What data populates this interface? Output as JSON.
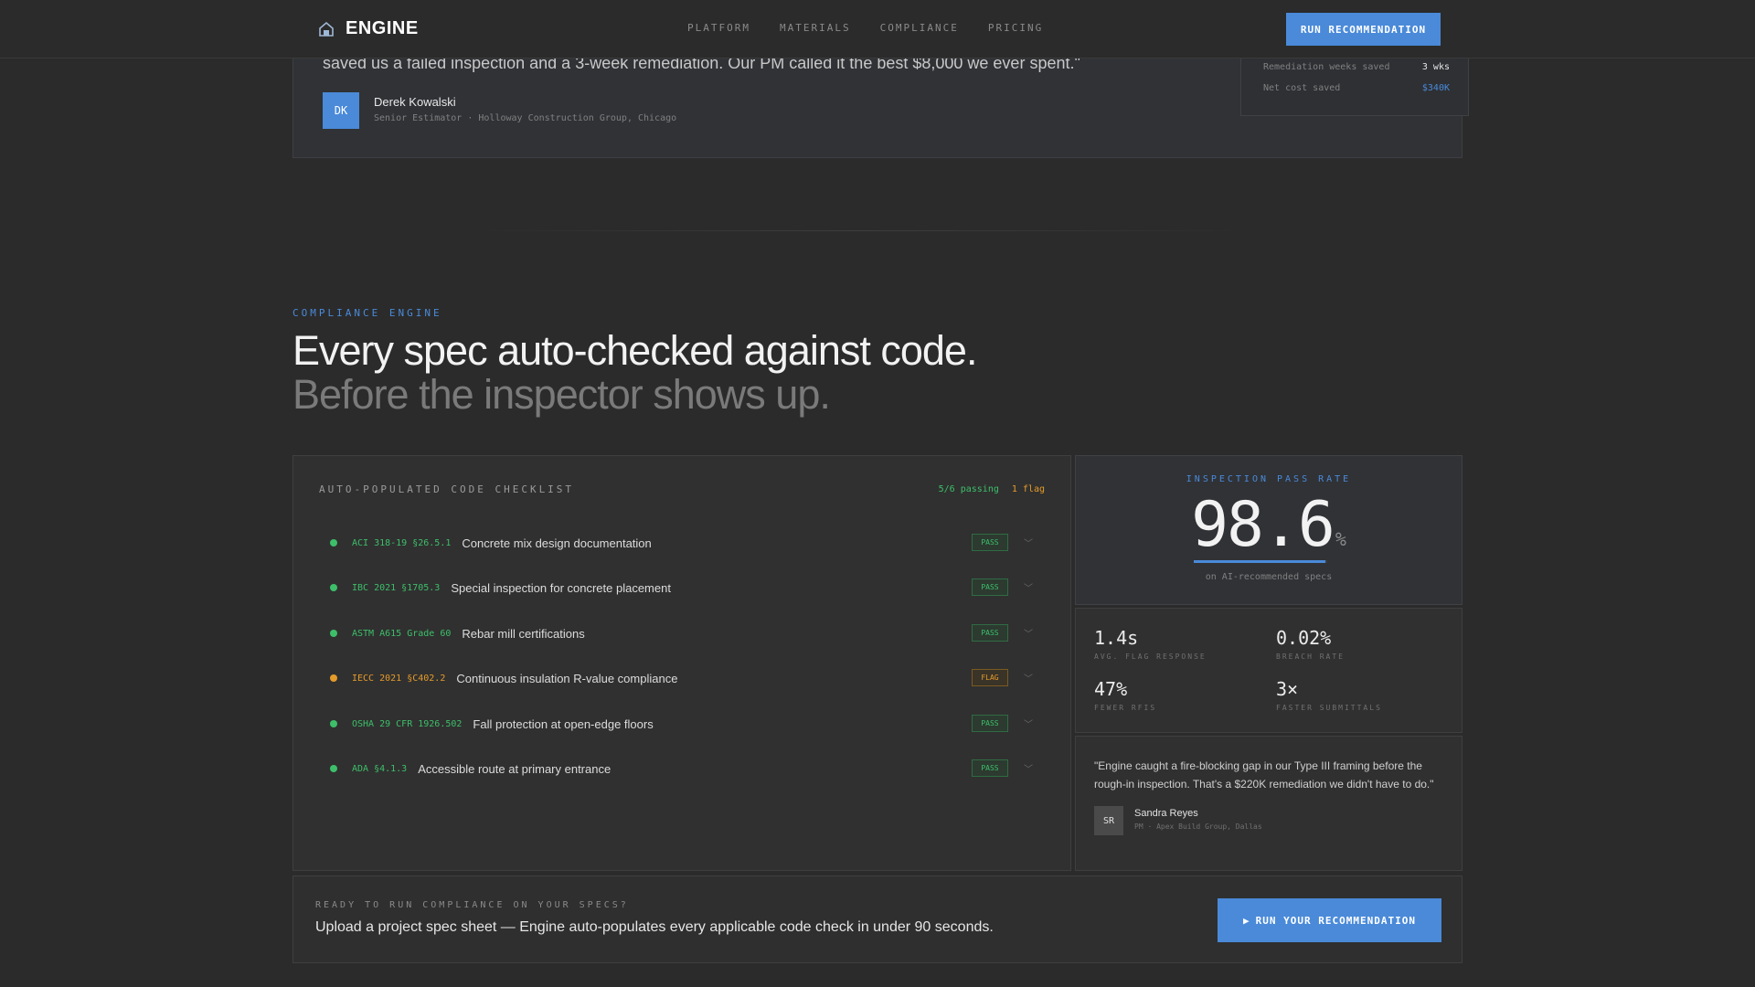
{
  "nav": {
    "brand": "ENGINE",
    "links": [
      "PLATFORM",
      "MATERIALS",
      "COMPLIANCE",
      "PRICING"
    ],
    "cta": "RUN RECOMMENDATION"
  },
  "top_testimonial": {
    "quote": "saved us a failed inspection and a 3-week remediation. Our PM called it the best $8,000 we ever spent.\"",
    "initials": "DK",
    "name": "Derek Kowalski",
    "role": "Senior Estimator · Holloway Construction Group, Chicago",
    "metrics": [
      {
        "label": "Remediation weeks saved",
        "value": "3 wks"
      },
      {
        "label": "Net cost saved",
        "value": "$340K"
      }
    ]
  },
  "section": {
    "eyebrow": "COMPLIANCE ENGINE",
    "headline": "Every spec auto-checked against code.",
    "subheadline": "Before the inspector shows up."
  },
  "checklist": {
    "title": "AUTO-POPULATED CODE CHECKLIST",
    "passing": "5/6 passing",
    "flags": "1 flag",
    "items": [
      {
        "code": "ACI 318-19 §26.5.1",
        "text": "Concrete mix design documentation",
        "status": "PASS"
      },
      {
        "code": "IBC 2021 §1705.3",
        "text": "Special inspection for concrete placement",
        "status": "PASS"
      },
      {
        "code": "ASTM A615 Grade 60",
        "text": "Rebar mill certifications",
        "status": "PASS"
      },
      {
        "code": "IECC 2021 §C402.2",
        "text": "Continuous insulation R-value compliance",
        "status": "FLAG"
      },
      {
        "code": "OSHA 29 CFR 1926.502",
        "text": "Fall protection at open-edge floors",
        "status": "PASS"
      },
      {
        "code": "ADA §4.1.3",
        "text": "Accessible route at primary entrance",
        "status": "PASS"
      }
    ]
  },
  "pass_rate": {
    "label": "INSPECTION PASS RATE",
    "value": "98.6",
    "unit": "%",
    "fill": 0.986,
    "sub": "on AI-recommended specs"
  },
  "stats": [
    {
      "value": "1.4s",
      "label": "AVG. FLAG RESPONSE"
    },
    {
      "value": "0.02%",
      "label": "BREACH RATE"
    },
    {
      "value": "47%",
      "label": "FEWER RFIS"
    },
    {
      "value": "3×",
      "label": "FASTER SUBMITTALS"
    }
  ],
  "side_quote": {
    "text": "\"Engine caught a fire-blocking gap in our Type III framing before the rough-in inspection. That's a $220K remediation we didn't have to do.\"",
    "initials": "SR",
    "name": "Sandra Reyes",
    "role": "PM · Apex Build Group, Dallas"
  },
  "cta": {
    "eyebrow": "READY TO RUN COMPLIANCE ON YOUR SPECS?",
    "text": "Upload a project spec sheet — Engine auto-populates every applicable code check in under 90 seconds.",
    "button": "RUN YOUR RECOMMENDATION",
    "button_icon": "▶"
  },
  "colors": {
    "accent": "#4a8ad9",
    "pass": "#3dbf6a",
    "flag": "#e59b2a",
    "background": "#2b2b2b"
  }
}
